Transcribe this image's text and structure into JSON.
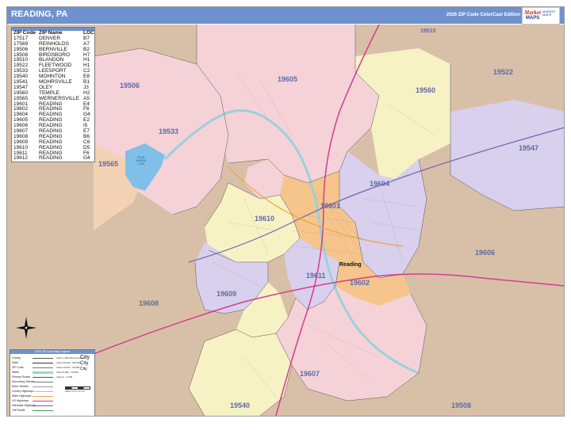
{
  "header": {
    "title": "READING, PA",
    "edition": "2026 ZIP Code ColorCast Edition"
  },
  "logo": {
    "market": "Market",
    "maps": "MAPS",
    "sub1": "MARKET",
    "sub2": "MAPS"
  },
  "zip_table": {
    "columns": [
      "ZIP Code",
      "ZIP Name",
      "LOC"
    ],
    "rows": [
      {
        "zip": "17517",
        "name": "DENVER",
        "loc": "B7"
      },
      {
        "zip": "17569",
        "name": "REINHOLDS",
        "loc": "A7"
      },
      {
        "zip": "19506",
        "name": "BERNVILLE",
        "loc": "B2"
      },
      {
        "zip": "19508",
        "name": "BIRDSBORO",
        "loc": "H7"
      },
      {
        "zip": "19510",
        "name": "BLANDON",
        "loc": "H1"
      },
      {
        "zip": "19522",
        "name": "FLEETWOOD",
        "loc": "H1"
      },
      {
        "zip": "19533",
        "name": "LEESPORT",
        "loc": "C2"
      },
      {
        "zip": "19540",
        "name": "MOHNTON",
        "loc": "E8"
      },
      {
        "zip": "19541",
        "name": "MOHRSVILLE",
        "loc": "B1"
      },
      {
        "zip": "19547",
        "name": "OLEY",
        "loc": "J3"
      },
      {
        "zip": "19560",
        "name": "TEMPLE",
        "loc": "H2"
      },
      {
        "zip": "19565",
        "name": "WERNERSVILLE",
        "loc": "A5"
      },
      {
        "zip": "19601",
        "name": "READING",
        "loc": "E4"
      },
      {
        "zip": "19602",
        "name": "READING",
        "loc": "F6"
      },
      {
        "zip": "19604",
        "name": "READING",
        "loc": "G4"
      },
      {
        "zip": "19605",
        "name": "READING",
        "loc": "E2"
      },
      {
        "zip": "19606",
        "name": "READING",
        "loc": "I5"
      },
      {
        "zip": "19607",
        "name": "READING",
        "loc": "E7"
      },
      {
        "zip": "19608",
        "name": "READING",
        "loc": "B6"
      },
      {
        "zip": "19609",
        "name": "READING",
        "loc": "C6"
      },
      {
        "zip": "19610",
        "name": "READING",
        "loc": "D5"
      },
      {
        "zip": "19611",
        "name": "READING",
        "loc": "F6"
      },
      {
        "zip": "19612",
        "name": "READING",
        "loc": "G4"
      }
    ]
  },
  "map": {
    "colors": {
      "tan": "#d8c0a8",
      "pink": "#f5d2d8",
      "yellow": "#f7f2c4",
      "lavender": "#d8d0ec",
      "peach": "#f3d2b4",
      "orange": "#f5c58c",
      "river": "#9ad3d8",
      "lake": "#7fbfe8",
      "highway": "#d63b8f",
      "interstate": "#7a5fb0",
      "state_route": "#f0a23c",
      "zip_label": "#5d6aa6"
    },
    "zip_labels": [
      "19510",
      "19522",
      "19506",
      "19605",
      "19560",
      "19533",
      "19547",
      "19565",
      "19604",
      "19601",
      "19610",
      "19606",
      "19611",
      "19602",
      "19609",
      "19608",
      "19607",
      "19540",
      "19508"
    ],
    "city_label": "Reading",
    "lake_label": "BLUE MARSH LAKE"
  },
  "legend": {
    "title": "2026 ZIP Code Map Legend",
    "items": [
      "County",
      "State",
      "ZIP Code",
      "Water",
      "Primary Roads",
      "Secondary Streets",
      "Minor Streets",
      "County Highways",
      "State Highways",
      "US Highways",
      "Interstate Highways",
      "Toll Roads"
    ],
    "populations": [
      "Cities 1,000,000 and Above",
      "Cities 60,000 - 999,999",
      "Cities 20,000 - 59,999",
      "Cities 5,000 - 19,999",
      "Cities 0 - 4,999"
    ],
    "city_samples": [
      "City",
      "City",
      "City"
    ],
    "scale": "Miles  0  0.5  1  1.5  2"
  }
}
